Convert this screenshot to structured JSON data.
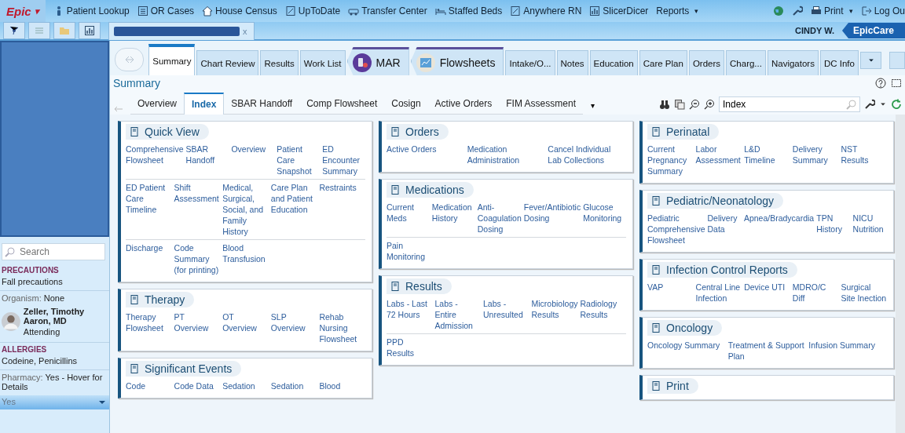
{
  "toolbar": {
    "logo": "Epic",
    "logo_caret": "▾",
    "items": [
      {
        "label": "Patient Lookup"
      },
      {
        "label": "OR Cases"
      },
      {
        "label": "House Census"
      },
      {
        "label": "UpToDate"
      },
      {
        "label": "Transfer Center"
      },
      {
        "label": "Staffed Beds"
      },
      {
        "label": "Anywhere RN"
      },
      {
        "label": "SlicerDicer"
      },
      {
        "label": "Reports",
        "caret": "▾"
      }
    ],
    "print": "Print",
    "print_caret": "▾",
    "logout": "Log Ou"
  },
  "session": {
    "tab_close": "x",
    "user": "CINDY W.",
    "app": "EpicCare"
  },
  "sidebar": {
    "search_placeholder": "Search",
    "precautions_heading": "PRECAUTIONS",
    "precautions": "Fall precautions",
    "organism_label": "Organism:",
    "organism": "None",
    "provider_name": "Zeller, Timothy Aaron, MD",
    "provider_role": "Attending",
    "allergies_heading": "ALLERGIES",
    "allergies": "Codeine, Penicillins",
    "pharmacy_label": "Pharmacy:",
    "pharmacy": "Yes - Hover for Details",
    "pharmacy_more": "Yes"
  },
  "activity_tabs": [
    {
      "label": "Summary",
      "selected": true,
      "kind": "plain"
    },
    {
      "label": "Chart Review",
      "selected": false,
      "kind": "plain"
    },
    {
      "label": "Results",
      "selected": false,
      "kind": "plain"
    },
    {
      "label": "Work List",
      "selected": false,
      "kind": "plain"
    },
    {
      "label": "MAR",
      "selected": false,
      "kind": "app"
    },
    {
      "label": "Flowsheets",
      "selected": false,
      "kind": "app"
    },
    {
      "label": "Intake/O...",
      "selected": false,
      "kind": "plain"
    },
    {
      "label": "Notes",
      "selected": false,
      "kind": "plain"
    },
    {
      "label": "Education",
      "selected": false,
      "kind": "plain"
    },
    {
      "label": "Care Plan",
      "selected": false,
      "kind": "plain"
    },
    {
      "label": "Orders",
      "selected": false,
      "kind": "plain"
    },
    {
      "label": "Charg...",
      "selected": false,
      "kind": "plain"
    },
    {
      "label": "Navigators",
      "selected": false,
      "kind": "plain"
    },
    {
      "label": "DC Info",
      "selected": false,
      "kind": "plain"
    }
  ],
  "page_title": "Summary",
  "sub_tabs": [
    {
      "label": "Overview",
      "selected": false
    },
    {
      "label": "Index",
      "selected": true
    },
    {
      "label": "SBAR Handoff",
      "selected": false
    },
    {
      "label": "Comp Flowsheet",
      "selected": false
    },
    {
      "label": "Cosign",
      "selected": false
    },
    {
      "label": "Active Orders",
      "selected": false
    },
    {
      "label": "FIM Assessment",
      "selected": false
    }
  ],
  "sub_tabs_more": "▾",
  "index_search": {
    "value": "Index"
  },
  "columns": [
    [
      {
        "title": "Quick View",
        "rows": [
          [
            "Comprehensive Flowsheet",
            "SBAR Handoff",
            "Overview",
            "Patient Care Snapshot",
            "ED Encounter Summary"
          ],
          [
            "ED Patient Care Timeline",
            "Shift Assessment",
            "Medical, Surgical, Social, and Family History",
            "Care Plan and Patient Education",
            "Restraints"
          ],
          [
            "Discharge",
            "Code Summary (for printing)",
            "Blood Transfusion"
          ]
        ]
      },
      {
        "title": "Therapy",
        "rows": [
          [
            "Therapy Flowsheet",
            "PT Overview",
            "OT Overview",
            "SLP Overview",
            "Rehab Nursing Flowsheet"
          ]
        ]
      },
      {
        "title": "Significant Events",
        "rows": [
          [
            "Code",
            "Code Data",
            "Sedation",
            "Sedation",
            "Blood"
          ]
        ]
      }
    ],
    [
      {
        "title": "Orders",
        "rows": [
          [
            "Active Orders",
            "Medication Administration",
            "Cancel Individual Lab Collections"
          ]
        ]
      },
      {
        "title": "Medications",
        "rows": [
          [
            "Current Meds",
            "Medication History",
            "Anti-Coagulation Dosing",
            "Fever/Antibiotic Dosing",
            "Glucose Monitoring"
          ],
          [
            "Pain Monitoring"
          ]
        ]
      },
      {
        "title": "Results",
        "rows": [
          [
            "Labs - Last 72 Hours",
            "Labs - Entire Admission",
            "Labs - Unresulted",
            "Microbiology Results",
            "Radiology Results"
          ],
          [
            "PPD Results"
          ]
        ]
      }
    ],
    [
      {
        "title": "Perinatal",
        "rows": [
          [
            "Current Pregnancy Summary",
            "Labor Assessment",
            "L&D Timeline",
            "Delivery Summary",
            "NST Results"
          ]
        ]
      },
      {
        "title": "Pediatric/Neonatology",
        "rows": [
          [
            "Pediatric Comprehensive Flowsheet",
            "Delivery Data",
            "Apnea/Bradycardia",
            "TPN History",
            "NICU Nutrition"
          ]
        ]
      },
      {
        "title": "Infection Control Reports",
        "rows": [
          [
            "VAP",
            "Central Line Infection",
            "Device UTI",
            "MDRO/C Diff",
            "Surgical Site Inection"
          ]
        ]
      },
      {
        "title": "Oncology",
        "rows": [
          [
            "Oncology Summary",
            "Treatment & Support Plan",
            "Infusion Summary"
          ]
        ]
      },
      {
        "title": "Print"
      }
    ]
  ]
}
